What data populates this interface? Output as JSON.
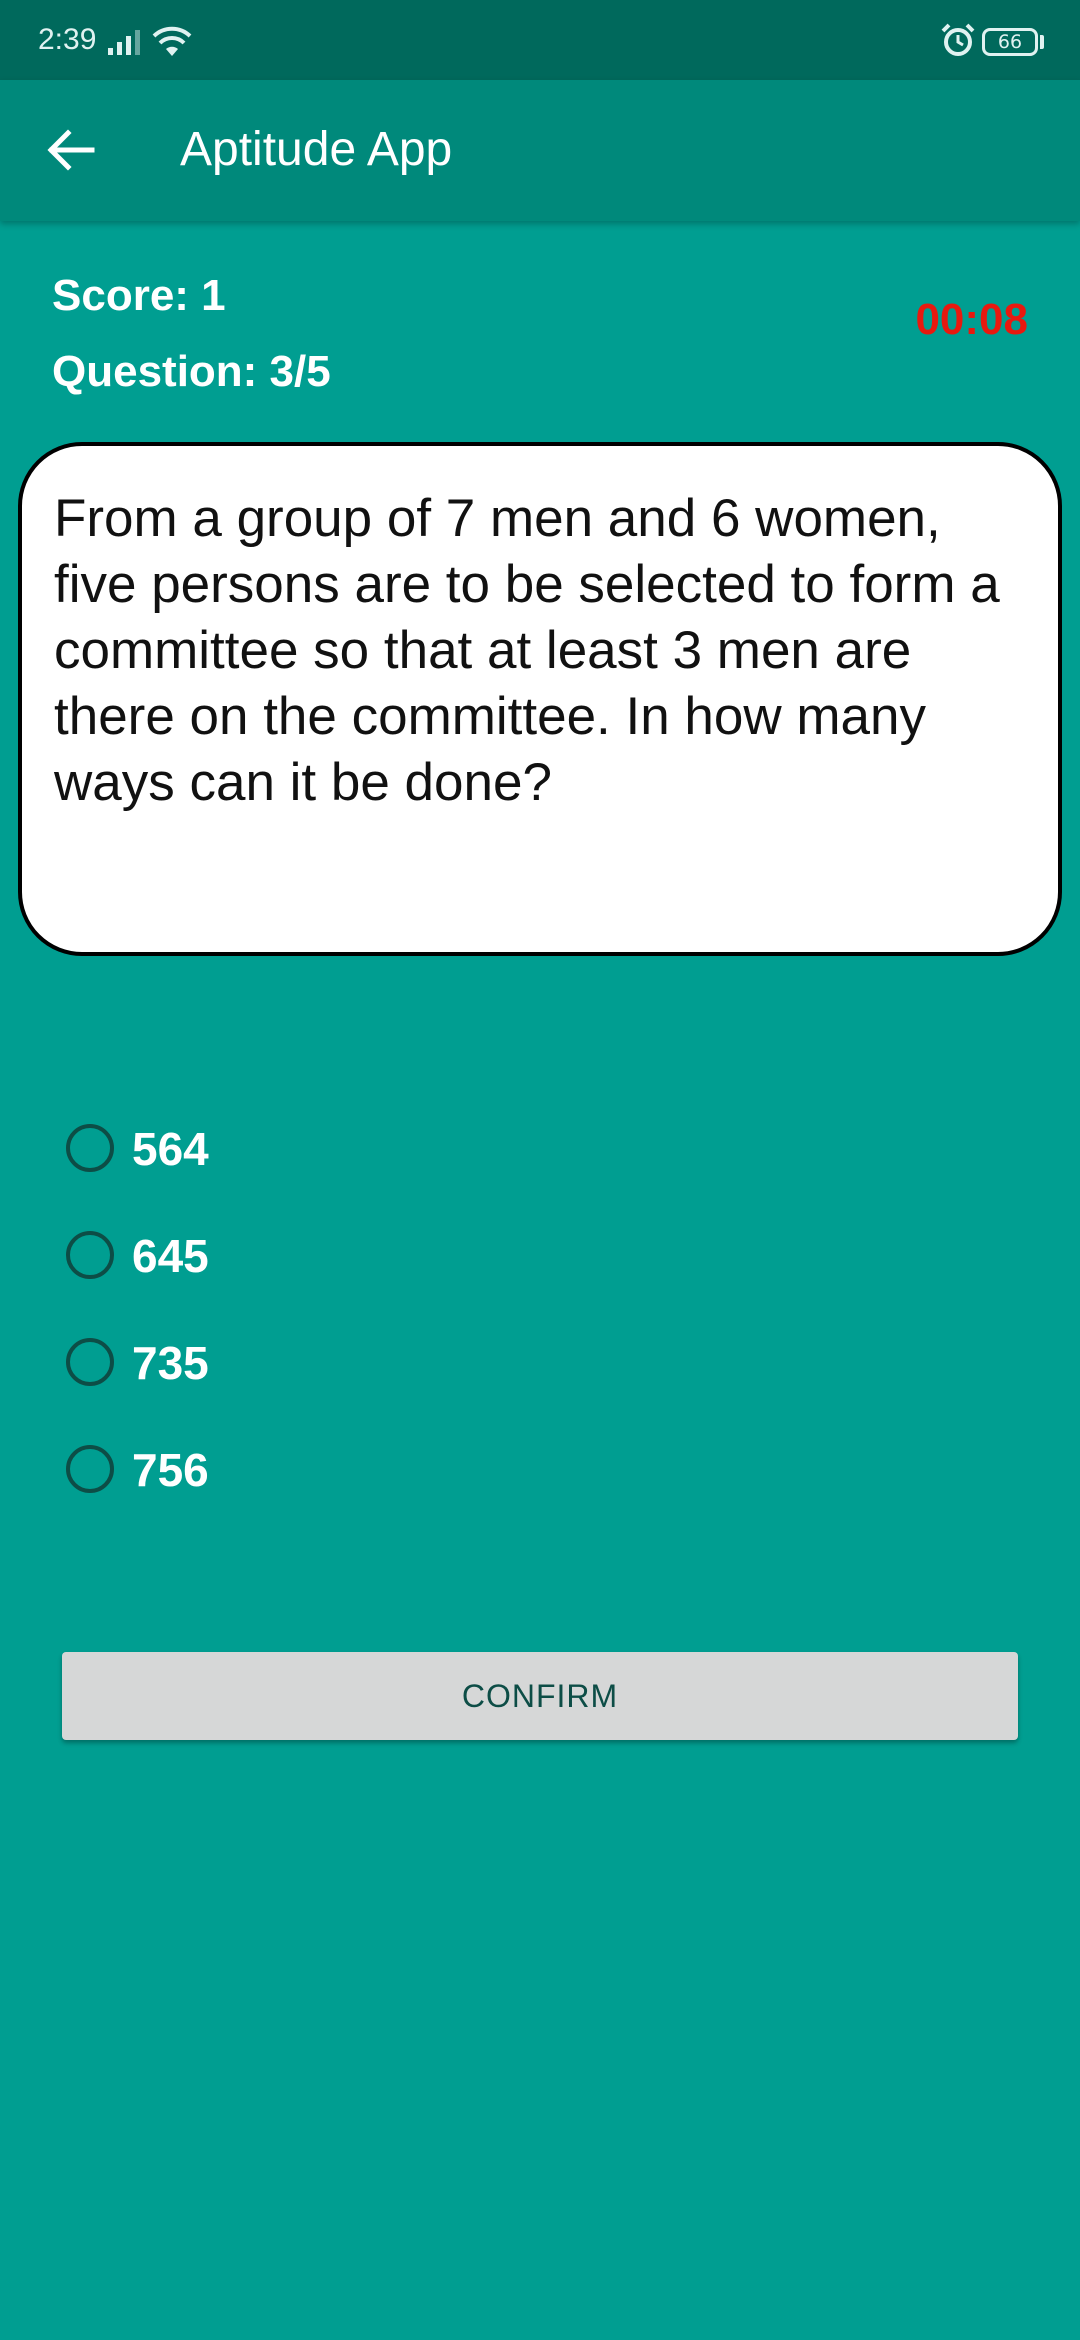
{
  "status_bar": {
    "time": "2:39",
    "battery": "66",
    "icons": [
      "signal-icon",
      "wifi-icon",
      "alarm-icon",
      "battery-icon"
    ]
  },
  "app_bar": {
    "title": "Aptitude App",
    "back_icon": "arrow-back-icon"
  },
  "quiz": {
    "score": "Score: 1",
    "question_count": "Question: 3/5",
    "timer": "00:08",
    "question": "From a group of 7 men and 6 women, five persons are to be selected to form a committee so that at least 3 men are there on the committee. In how many ways can it be done?",
    "options": [
      {
        "label": "564"
      },
      {
        "label": "645"
      },
      {
        "label": "735"
      },
      {
        "label": "756"
      }
    ],
    "confirm_label": "CONFIRM"
  },
  "colors": {
    "background": "#009e91",
    "app_bar": "#00897b",
    "status_bar": "#00695c",
    "timer": "#e8190f",
    "button": "#d6d7d7"
  }
}
